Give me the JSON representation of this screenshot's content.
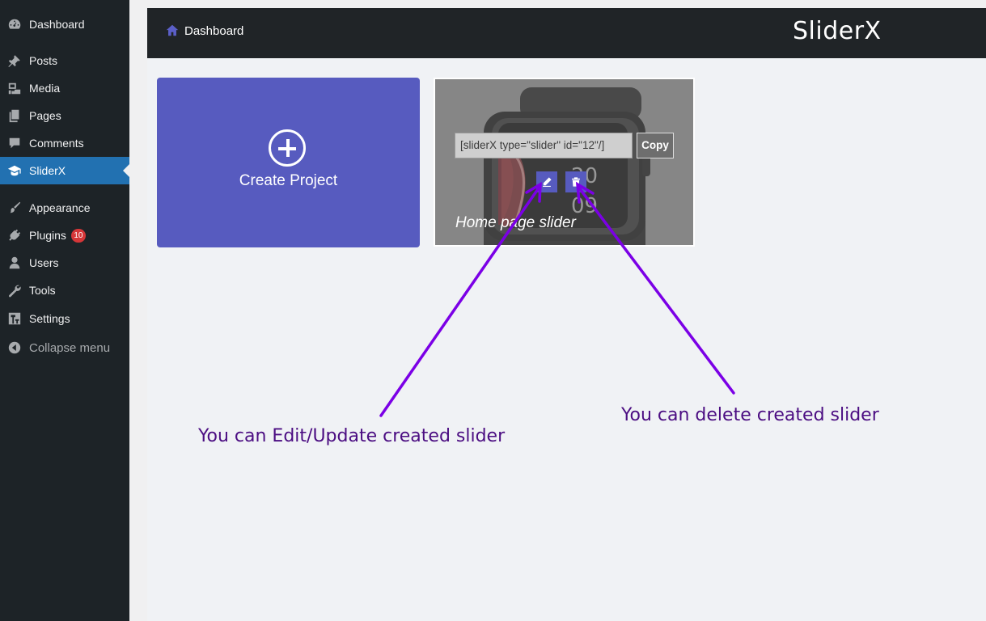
{
  "sidebar": {
    "items": [
      {
        "label": "Dashboard",
        "icon": "dashboard-icon"
      },
      {
        "label": "Posts",
        "icon": "pin-icon"
      },
      {
        "label": "Media",
        "icon": "media-icon"
      },
      {
        "label": "Pages",
        "icon": "pages-icon"
      },
      {
        "label": "Comments",
        "icon": "comment-icon"
      },
      {
        "label": "SliderX",
        "icon": "mortarboard-icon",
        "current": true
      },
      {
        "label": "Appearance",
        "icon": "brush-icon"
      },
      {
        "label": "Plugins",
        "icon": "plug-icon",
        "badge": "10"
      },
      {
        "label": "Users",
        "icon": "user-icon"
      },
      {
        "label": "Tools",
        "icon": "wrench-icon"
      },
      {
        "label": "Settings",
        "icon": "settings-icon"
      },
      {
        "label": "Collapse menu",
        "icon": "collapse-icon"
      }
    ]
  },
  "header": {
    "breadcrumb": "Dashboard",
    "logo": "SliderX"
  },
  "create_card": {
    "label": "Create Project"
  },
  "slider_card": {
    "shortcode": "[sliderX type=\"slider\" id=\"12\"/]",
    "copy_label": "Copy",
    "title": "Home page slider",
    "watch_time_top": "20",
    "watch_time_bottom": "09"
  },
  "annotations": {
    "edit_note": "You can Edit/Update created slider",
    "delete_note": "You can delete created slider",
    "color": "#7b00e6"
  },
  "colors": {
    "accent": "#575bbf",
    "sidebar_bg": "#1d2327",
    "sidebar_current": "#2271b1",
    "topbar_bg": "#202427",
    "badge": "#d63638"
  }
}
